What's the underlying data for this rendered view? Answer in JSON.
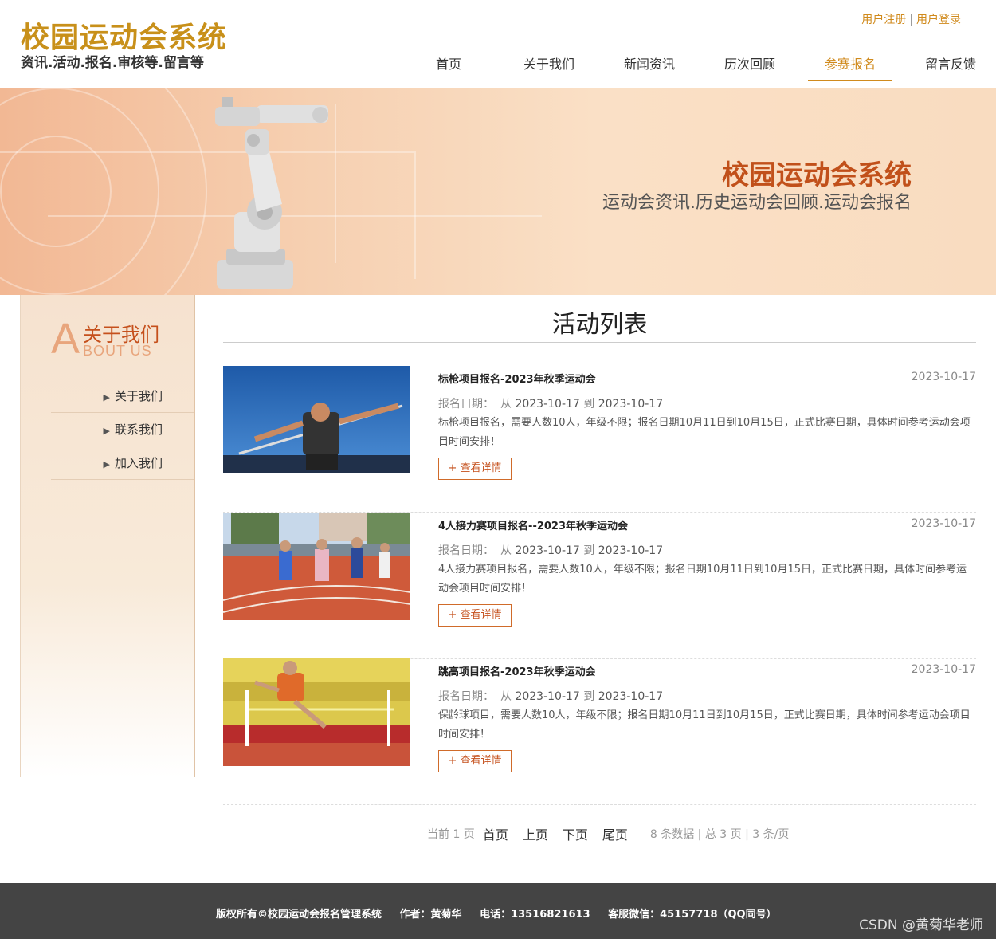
{
  "header": {
    "title": "校园运动会系统",
    "subtitle": "资讯.活动.报名.审核等.留言等",
    "register": "用户注册",
    "separator": "|",
    "login": "用户登录"
  },
  "nav": [
    "首页",
    "关于我们",
    "新闻资讯",
    "历次回顾",
    "参赛报名",
    "留言反馈"
  ],
  "nav_active": "参赛报名",
  "banner": {
    "title": "校园运动会系统",
    "subtitle": "运动会资讯.历史运动会回顾.运动会报名"
  },
  "sidebar": {
    "letter": "A",
    "title_cn": "关于我们",
    "title_en": "BOUT US",
    "items": [
      "关于我们",
      "联系我们",
      "加入我们"
    ]
  },
  "main": {
    "title": "活动列表",
    "period_label": "报名日期：",
    "from_word": "从",
    "to_word": "到",
    "detail_label": "+ 查看详情",
    "items": [
      {
        "title": "标枪项目报名-2023年秋季运动会",
        "date": "2023-10-17",
        "start": "2023-10-17",
        "end": "2023-10-17",
        "desc": "标枪项目报名，需要人数10人，年级不限；报名日期10月11日到10月15日，正式比赛日期，具体时间参考运动会项目时间安排！"
      },
      {
        "title": "4人接力赛项目报名--2023年秋季运动会",
        "date": "2023-10-17",
        "start": "2023-10-17",
        "end": "2023-10-17",
        "desc": "4人接力赛项目报名，需要人数10人，年级不限；报名日期10月11日到10月15日，正式比赛日期，具体时间参考运动会项目时间安排！"
      },
      {
        "title": "跳高项目报名-2023年秋季运动会",
        "date": "2023-10-17",
        "start": "2023-10-17",
        "end": "2023-10-17",
        "desc": "保龄球项目，需要人数10人，年级不限；报名日期10月11日到10月15日，正式比赛日期，具体时间参考运动会项目时间安排！"
      }
    ]
  },
  "pager": {
    "current": "当前 1 页",
    "first": "首页",
    "prev": "上页",
    "next": "下页",
    "last": "尾页",
    "stats": "8 条数据 | 总 3 页 | 3 条/页"
  },
  "footer": {
    "copyright": "版权所有©校园运动会报名管理系统",
    "author": "作者：黄菊华",
    "phone": "电话：13516821613",
    "wechat": "客服微信：45157718（QQ同号）",
    "watermark": "CSDN @黄菊华老师"
  },
  "colors": {
    "brand": "#c8901a",
    "accent": "#d08a1c",
    "banner_title": "#c1501a",
    "footer_bg": "#444444"
  }
}
